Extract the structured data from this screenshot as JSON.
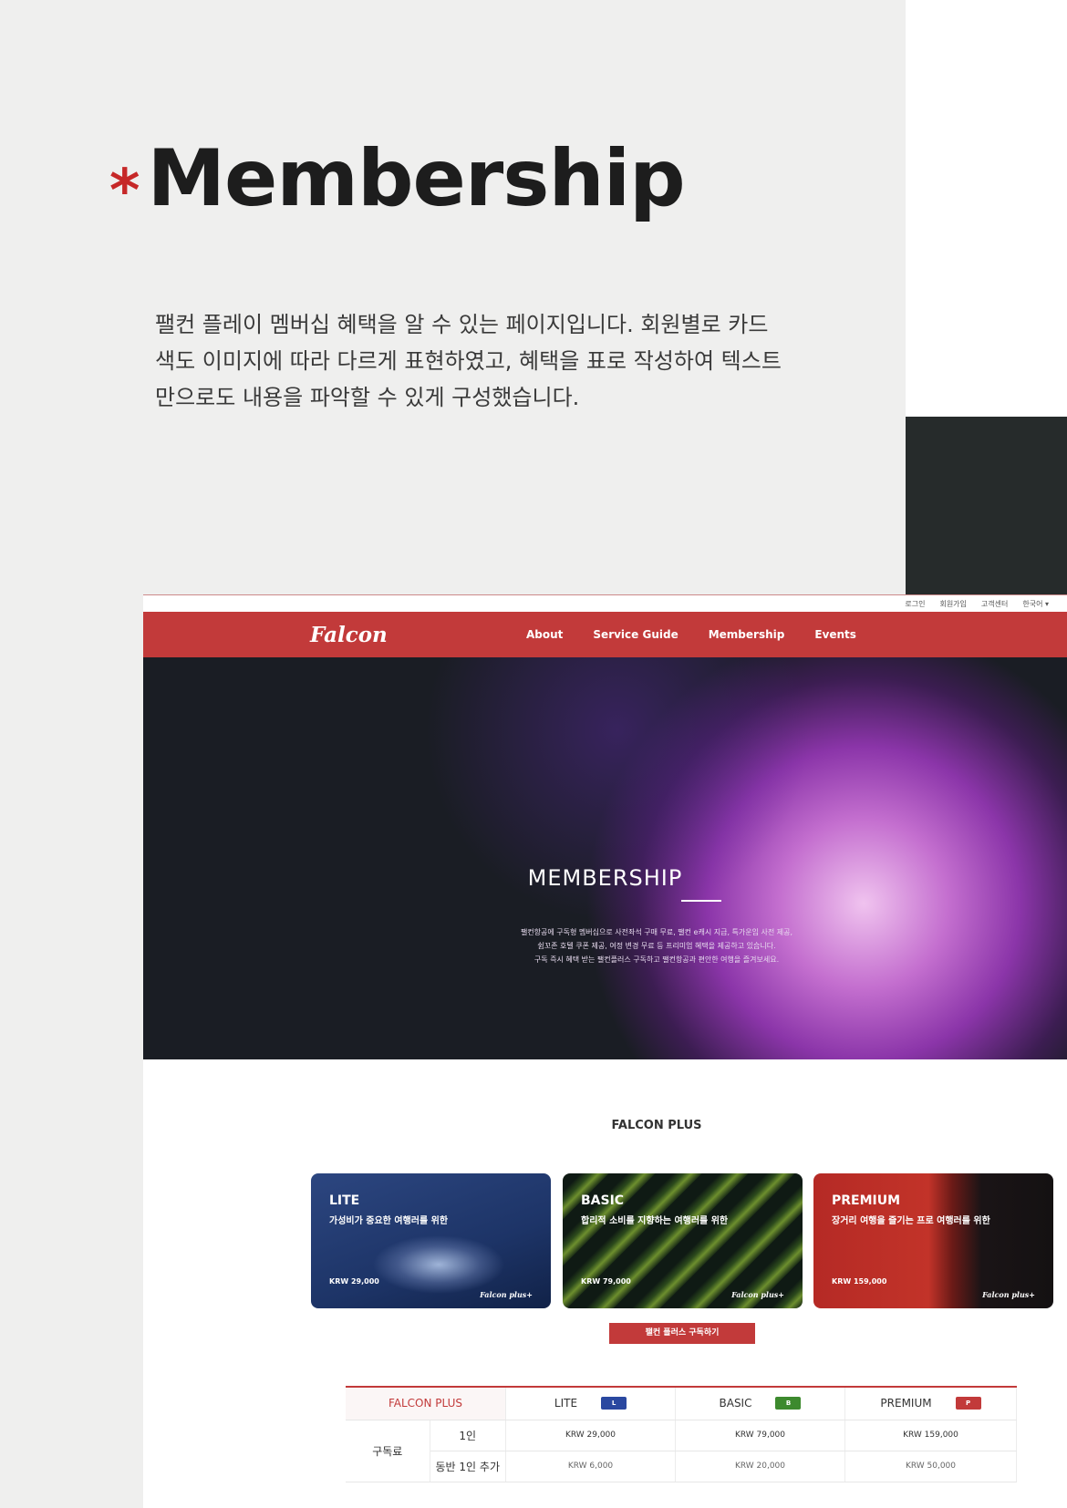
{
  "heading": {
    "asterisk": "*",
    "title": "Membership",
    "description": "팰컨 플레이 멤버십 혜택을 알 수 있는 페이지입니다. 회원별로 카드 색도 이미지에 따라 다르게 표현하였고, 혜택을 표로 작성하여 텍스트만으로도 내용을 파악할 수 있게 구성했습니다."
  },
  "screenshot": {
    "util_links": [
      "로그인",
      "회원가입",
      "고객센터",
      "한국어 ▾"
    ],
    "logo": "Falcon",
    "nav": [
      "About",
      "Service Guide",
      "Membership",
      "Events"
    ],
    "hero": {
      "title": "MEMBERSHIP",
      "desc_lines": [
        "팰컨항공에 구독형 멤버십으로 사전좌석 구매 무료, 팰컨 e캐시 지급, 특가운임 사전 제공,",
        "쉼꼬존 호텔 쿠폰 제공, 여정 변경 무료 등 프리미엄 혜택을 제공하고 있습니다.",
        "구독 즉시 혜택 받는 팰컨플러스 구독하고 팰컨항공과 편안한 여행을 즐겨보세요."
      ]
    },
    "plus_title": "FALCON PLUS",
    "cards": [
      {
        "name": "LITE",
        "sub": "가성비가 중요한 여행러를 위한",
        "price": "KRW 29,000",
        "brand": "Falcon plus+"
      },
      {
        "name": "BASIC",
        "sub": "합리적 소비를 지향하는 여행러를 위한",
        "price": "KRW 79,000",
        "brand": "Falcon plus+"
      },
      {
        "name": "PREMIUM",
        "sub": "장거리 여행을 즐기는 프로 여행러를 위한",
        "price": "KRW 159,000",
        "brand": "Falcon plus+"
      }
    ],
    "subscribe_button": "팰컨 플러스 구독하기",
    "table": {
      "header_label": "FALCON PLUS",
      "tiers": [
        {
          "name": "LITE",
          "badge": "L"
        },
        {
          "name": "BASIC",
          "badge": "B"
        },
        {
          "name": "PREMIUM",
          "badge": "P"
        }
      ],
      "group": "구독료",
      "rows": [
        {
          "label": "1인",
          "values": [
            "KRW 29,000",
            "KRW 79,000",
            "KRW 159,000"
          ]
        },
        {
          "label": "동반 1인 추가",
          "values": [
            "KRW 6,000",
            "KRW 20,000",
            "KRW 50,000"
          ]
        }
      ]
    }
  },
  "colors": {
    "accent": "#c23a3a",
    "dark_block": "#262b2b",
    "background": "#efefee"
  }
}
